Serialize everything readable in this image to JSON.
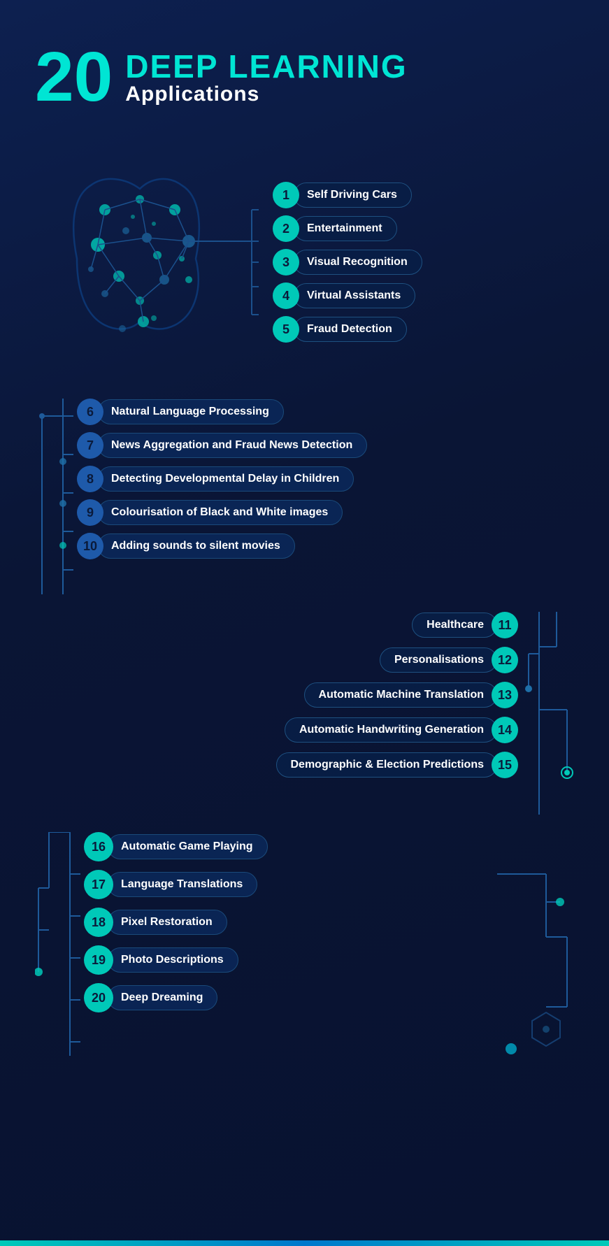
{
  "header": {
    "number": "20",
    "title": "DEEP LEARNING",
    "subtitle": "Applications"
  },
  "items": [
    {
      "id": 1,
      "label": "Self Driving Cars"
    },
    {
      "id": 2,
      "label": "Entertainment"
    },
    {
      "id": 3,
      "label": "Visual Recognition"
    },
    {
      "id": 4,
      "label": "Virtual Assistants"
    },
    {
      "id": 5,
      "label": "Fraud Detection"
    },
    {
      "id": 6,
      "label": "Natural Language Processing"
    },
    {
      "id": 7,
      "label": "News Aggregation and Fraud News Detection"
    },
    {
      "id": 8,
      "label": "Detecting Developmental Delay in Children"
    },
    {
      "id": 9,
      "label": "Colourisation of Black and White images"
    },
    {
      "id": 10,
      "label": "Adding sounds to silent movies"
    },
    {
      "id": 11,
      "label": "Healthcare"
    },
    {
      "id": 12,
      "label": "Personalisations"
    },
    {
      "id": 13,
      "label": "Automatic Machine Translation"
    },
    {
      "id": 14,
      "label": "Automatic Handwriting Generation"
    },
    {
      "id": 15,
      "label": "Demographic & Election Predictions"
    },
    {
      "id": 16,
      "label": "Automatic Game Playing"
    },
    {
      "id": 17,
      "label": "Language Translations"
    },
    {
      "id": 18,
      "label": "Pixel Restoration"
    },
    {
      "id": 19,
      "label": "Photo Descriptions"
    },
    {
      "id": 20,
      "label": "Deep Dreaming"
    }
  ]
}
